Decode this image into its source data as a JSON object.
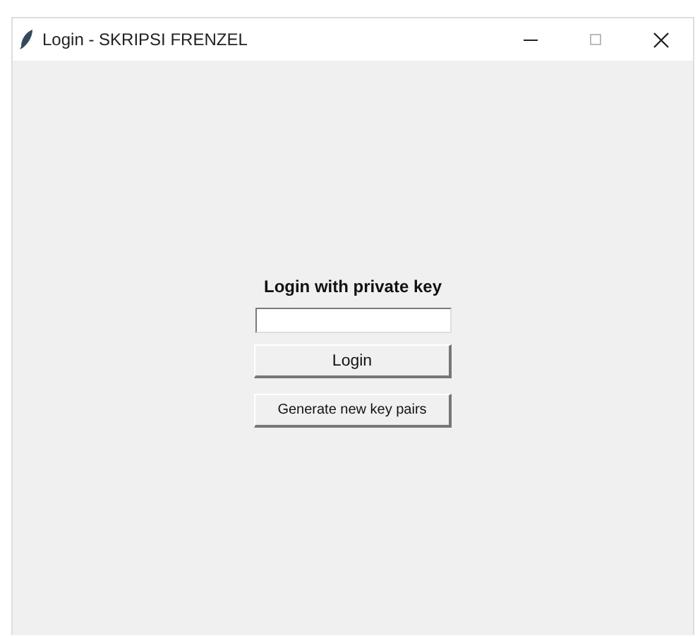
{
  "window": {
    "title": "Login - SKRIPSI FRENZEL"
  },
  "heading": "Login with private key",
  "buttons": [
    {
      "label": "Login",
      "kind": "large"
    },
    {
      "label": "Generate new key pairs",
      "kind": "small"
    }
  ]
}
